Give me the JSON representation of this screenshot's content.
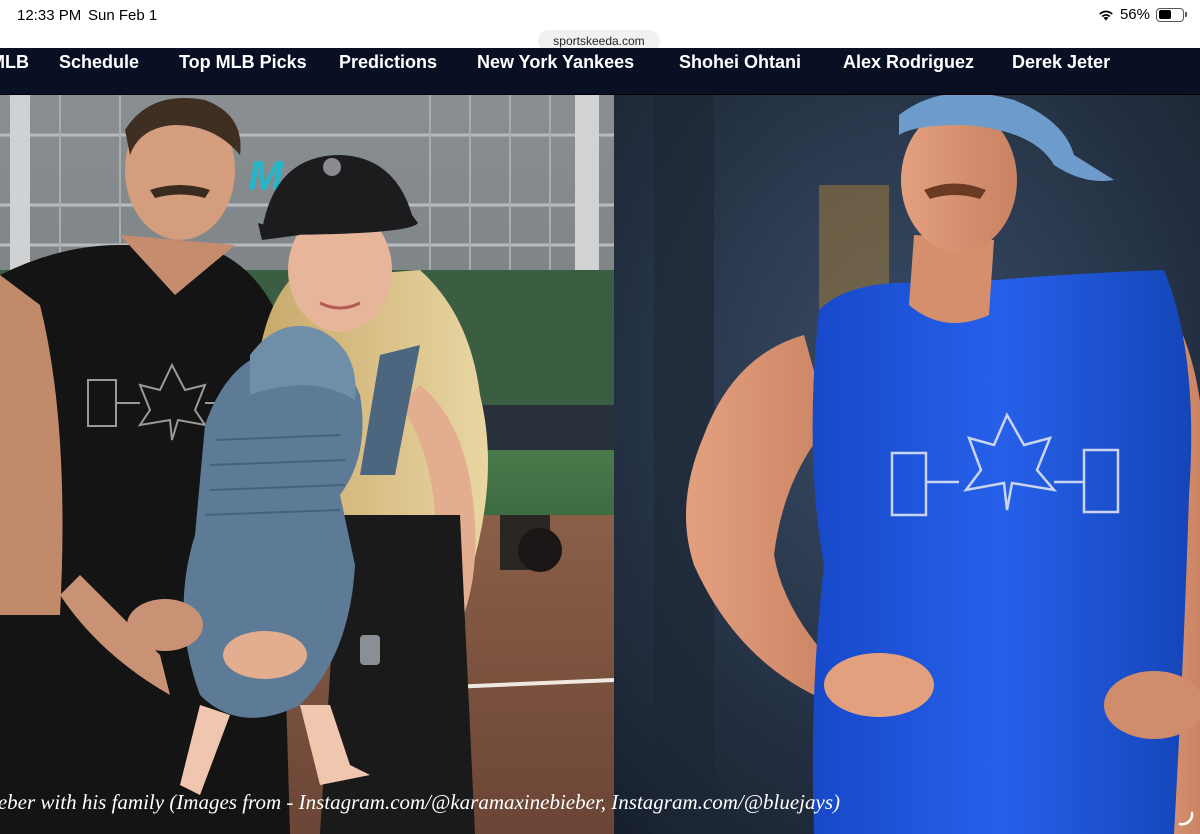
{
  "status_bar": {
    "time": "12:33 PM",
    "date": "Sun Feb 1",
    "battery_percent": "56%",
    "battery_level": 0.56
  },
  "browser": {
    "url": "sportskeeda.com"
  },
  "nav": {
    "items": [
      {
        "label": "MLB"
      },
      {
        "label": "Schedule"
      },
      {
        "label": "Top MLB Picks"
      },
      {
        "label": "Predictions"
      },
      {
        "label": "New York Yankees"
      },
      {
        "label": "Shohei Ohtani"
      },
      {
        "label": "Alex Rodriguez"
      },
      {
        "label": "Derek Jeter"
      }
    ]
  },
  "article": {
    "caption": "ieber with his family (Images from - Instagram.com/@karamaxinebieber, Instagram.com/@bluejays)"
  },
  "colors": {
    "nav_bg": "#0a1024",
    "shirt_blue": "#1f5be0",
    "jays_logo": "#c9d4ef"
  }
}
